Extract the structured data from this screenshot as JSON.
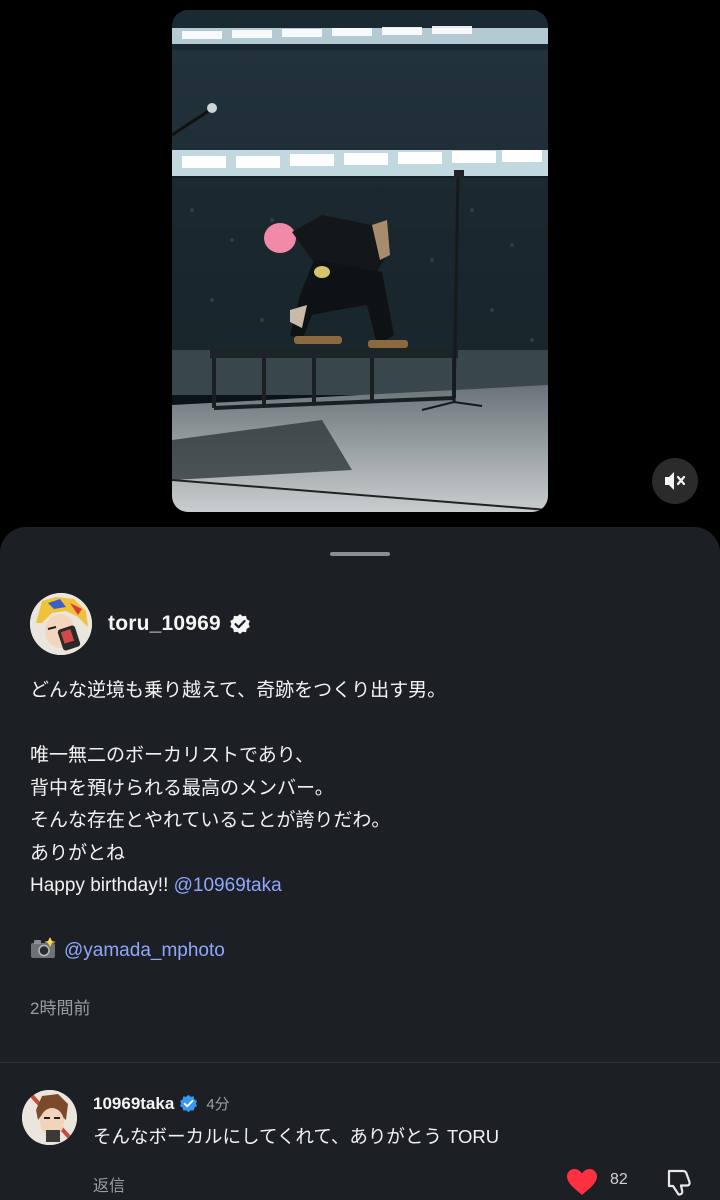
{
  "media": {
    "image_icon": "concert-photo",
    "mute_icon": "speaker-muted-icon"
  },
  "post": {
    "author": "toru_10969",
    "verified_icon": "verified-badge-icon",
    "caption": {
      "line1": "どんな逆境も乗り越えて、奇跡をつくり出す男。",
      "line2": "唯一無二のボーカリストであり、",
      "line3": "背中を預けられる最高のメンバー。",
      "line4": "そんな存在とやれていることが誇りだわ。",
      "line5": "ありがとね",
      "line6_text": "Happy birthday!! ",
      "line6_mention": "@10969taka",
      "line7_icon": "camera-flash-icon",
      "line7_mention": "@yamada_mphoto"
    },
    "time": "2時間前"
  },
  "comment": {
    "user": "10969taka",
    "time": "4分",
    "text": "そんなボーカルにしてくれて、ありがとう TORU",
    "reply_label": "返信",
    "likes": "82",
    "like_icon": "heart-icon",
    "dislike_icon": "thumbs-down-icon"
  },
  "colors": {
    "sheet_bg": "#1c1f23",
    "mention": "#8ea8ff",
    "verified": "#3897f0",
    "like": "#ff3040"
  }
}
